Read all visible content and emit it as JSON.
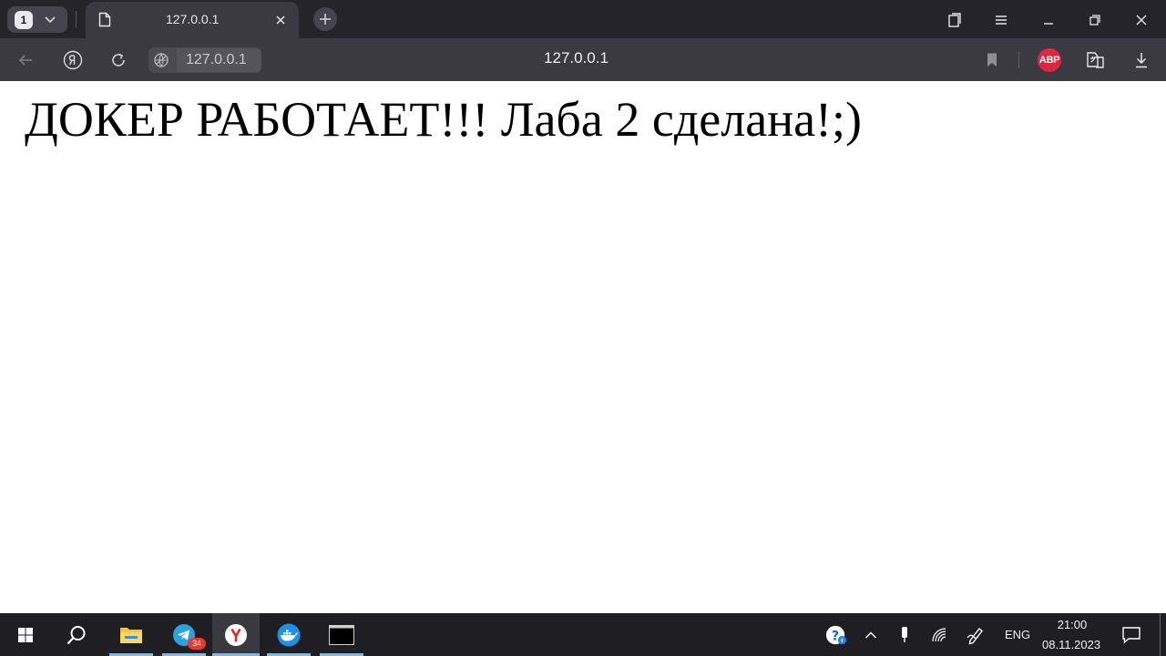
{
  "browser": {
    "tab_count": "1",
    "tab": {
      "title": "127.0.0.1"
    },
    "address": {
      "host_chip": "127.0.0.1",
      "center_title": "127.0.0.1"
    },
    "extension_abp_label": "ABP"
  },
  "page": {
    "heading": "ДОКЕР РАБОТАЕТ!!! Лаба 2 сделана!;)"
  },
  "taskbar": {
    "telegram_badge": "34",
    "language": "ENG",
    "time": "21:00",
    "date": "08.11.2023"
  },
  "colors": {
    "titlebar_bg": "#25242b",
    "toolbar_bg": "#3b3a42",
    "abp_red": "#e0263e",
    "taskbar_bg": "#1f1e22",
    "taskbar_accent": "#7ab7ea"
  }
}
